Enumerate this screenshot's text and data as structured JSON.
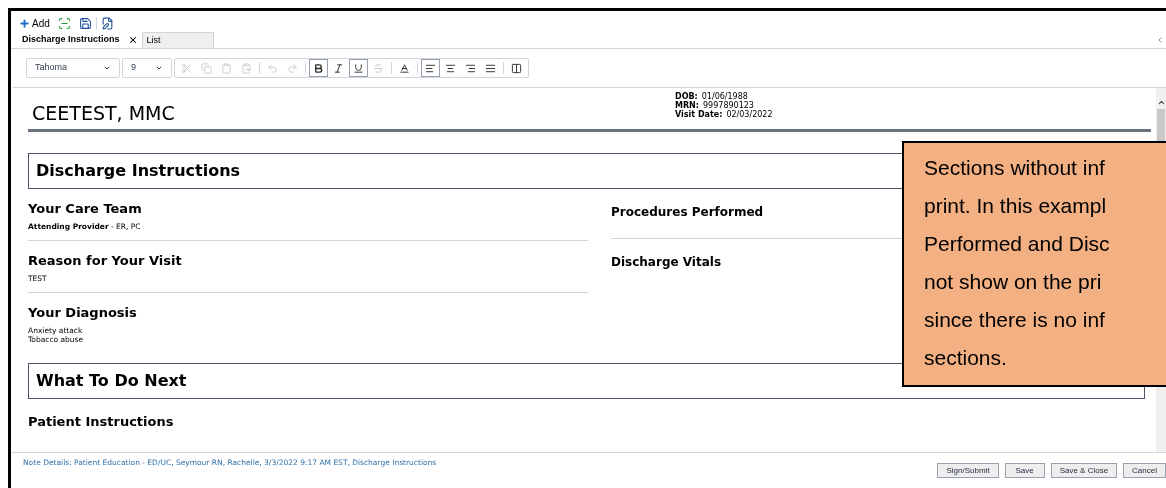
{
  "toolbar": {
    "add_label": "Add"
  },
  "tabs": [
    {
      "label": "Discharge Instructions",
      "selected": true
    },
    {
      "label": "List",
      "selected": false
    }
  ],
  "format_bar": {
    "font": "Tahoma",
    "size": "9",
    "buttons": [
      {
        "kind": "cut",
        "disabled": true,
        "active": false
      },
      {
        "kind": "copy",
        "disabled": true,
        "active": false
      },
      {
        "kind": "paste",
        "disabled": true,
        "active": false
      },
      {
        "kind": "paste-special",
        "disabled": true,
        "active": false
      },
      {
        "kind": "sep"
      },
      {
        "kind": "undo",
        "disabled": true,
        "active": false
      },
      {
        "kind": "redo",
        "disabled": true,
        "active": false
      },
      {
        "kind": "sep"
      },
      {
        "kind": "bold",
        "disabled": false,
        "active": true
      },
      {
        "kind": "italic",
        "disabled": false,
        "active": false
      },
      {
        "kind": "underline",
        "disabled": false,
        "active": true
      },
      {
        "kind": "strike",
        "disabled": true,
        "active": false
      },
      {
        "kind": "sep"
      },
      {
        "kind": "font-color",
        "disabled": false,
        "active": false
      },
      {
        "kind": "sep"
      },
      {
        "kind": "align-left",
        "disabled": false,
        "active": true
      },
      {
        "kind": "align-center",
        "disabled": false,
        "active": false
      },
      {
        "kind": "align-right",
        "disabled": false,
        "active": false
      },
      {
        "kind": "justify",
        "disabled": false,
        "active": false
      },
      {
        "kind": "sep"
      },
      {
        "kind": "special",
        "disabled": false,
        "active": false
      }
    ]
  },
  "patient": {
    "name": "CEETEST, MMC",
    "details": [
      {
        "label": "DOB:",
        "value": "01/06/1988"
      },
      {
        "label": "MRN:",
        "value": "9997890123"
      },
      {
        "label": "Visit Date:",
        "value": "02/03/2022"
      }
    ]
  },
  "document": {
    "title": "Discharge Instructions",
    "left_sections": [
      {
        "heading": "Your Care Team",
        "lines": [
          "**Attending Provider** - ER, PC"
        ]
      },
      {
        "heading": "Reason for Your Visit",
        "lines": [
          "TEST"
        ]
      },
      {
        "heading": "Your Diagnosis",
        "lines": [
          "Anxiety attack",
          "Tobacco abuse"
        ]
      }
    ],
    "right_sections": [
      {
        "heading": "Procedures Performed"
      },
      {
        "heading": "Discharge Vitals"
      }
    ],
    "next_title": "What To Do Next",
    "next_sections": [
      {
        "heading": "Patient Instructions"
      }
    ]
  },
  "note_details": "Note Details: Patient Education - ED/UC, Seymour RN, Rachelle, 3/3/2022 9:17 AM EST, Discharge Instructions",
  "buttons": [
    "Sign/Submit",
    "Save",
    "Save & Close",
    "Cancel"
  ],
  "callout": {
    "lines": [
      "Sections without inf",
      "print. In this exampl",
      "Performed and Disc",
      "not show on the pri",
      "since there is no inf",
      "sections."
    ]
  }
}
